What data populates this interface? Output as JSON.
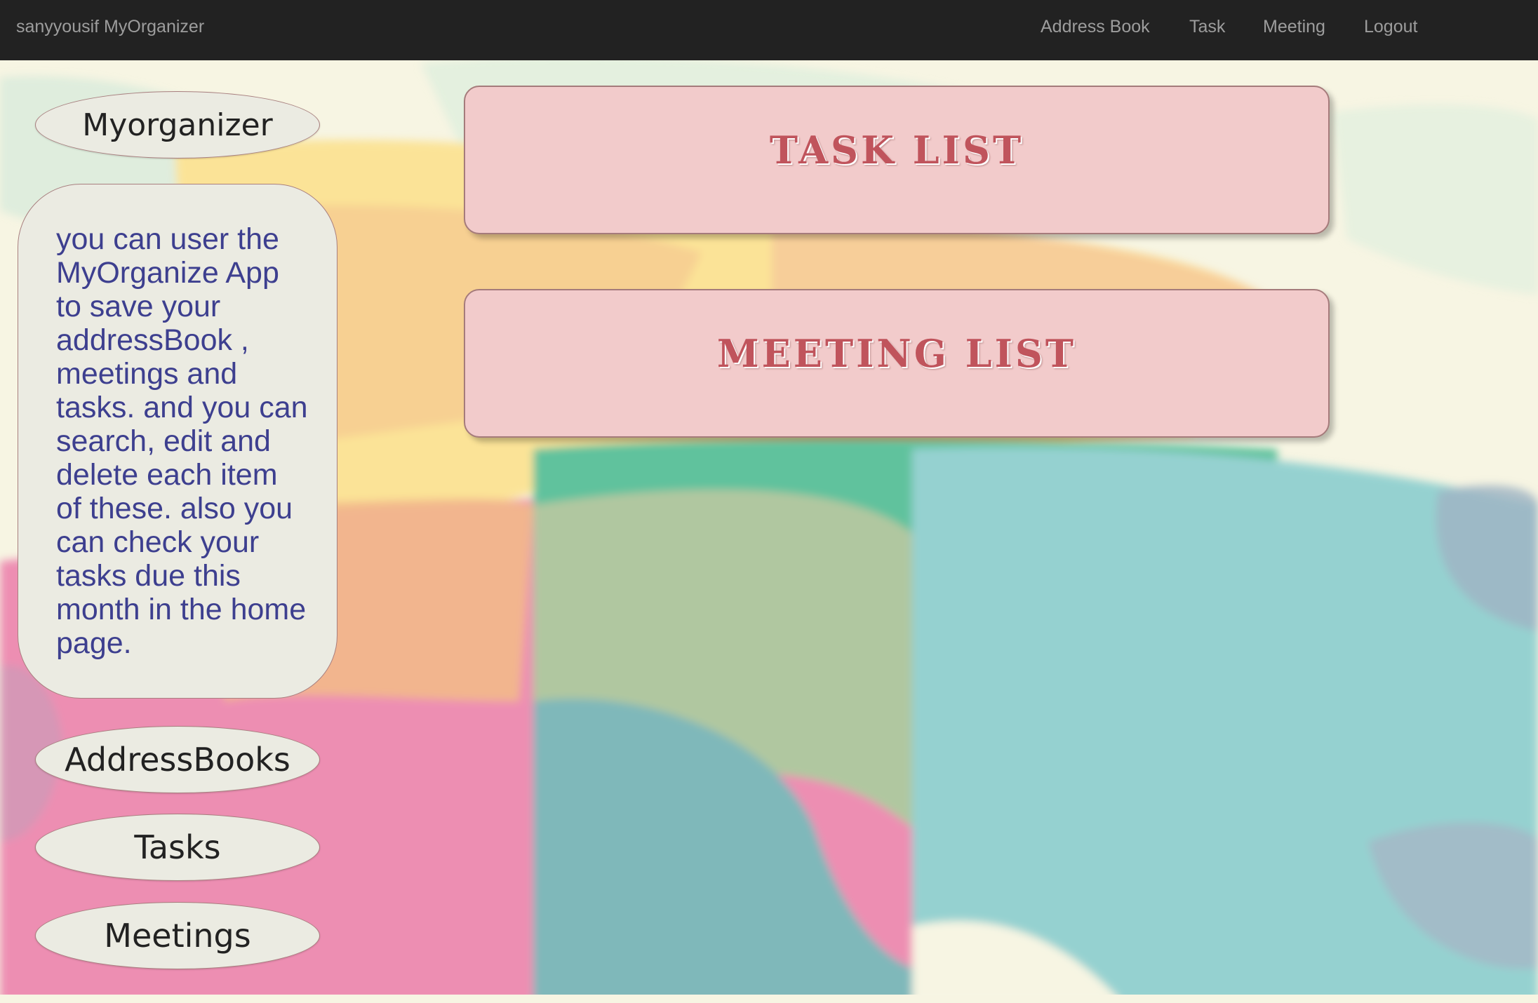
{
  "navbar": {
    "brand": "sanyyousif MyOrganizer",
    "links": [
      "Address Book",
      "Task",
      "Meeting",
      "Logout"
    ]
  },
  "sidebar": {
    "title": "Myorganizer",
    "description": "you can user the MyOrganize App to save your addressBook , meetings and tasks. and you can search, edit and delete each item of these. also you can check your tasks due this month in the home page.",
    "buttons": [
      "AddressBooks",
      "Tasks",
      "Meetings"
    ]
  },
  "main": {
    "cards": [
      "TASK LIST",
      "MEETING LIST"
    ]
  },
  "colors": {
    "navbar": "#222222",
    "card_bg": "#f2cbcb",
    "card_title": "#c0545c",
    "desc_text": "#3d3f8f"
  }
}
